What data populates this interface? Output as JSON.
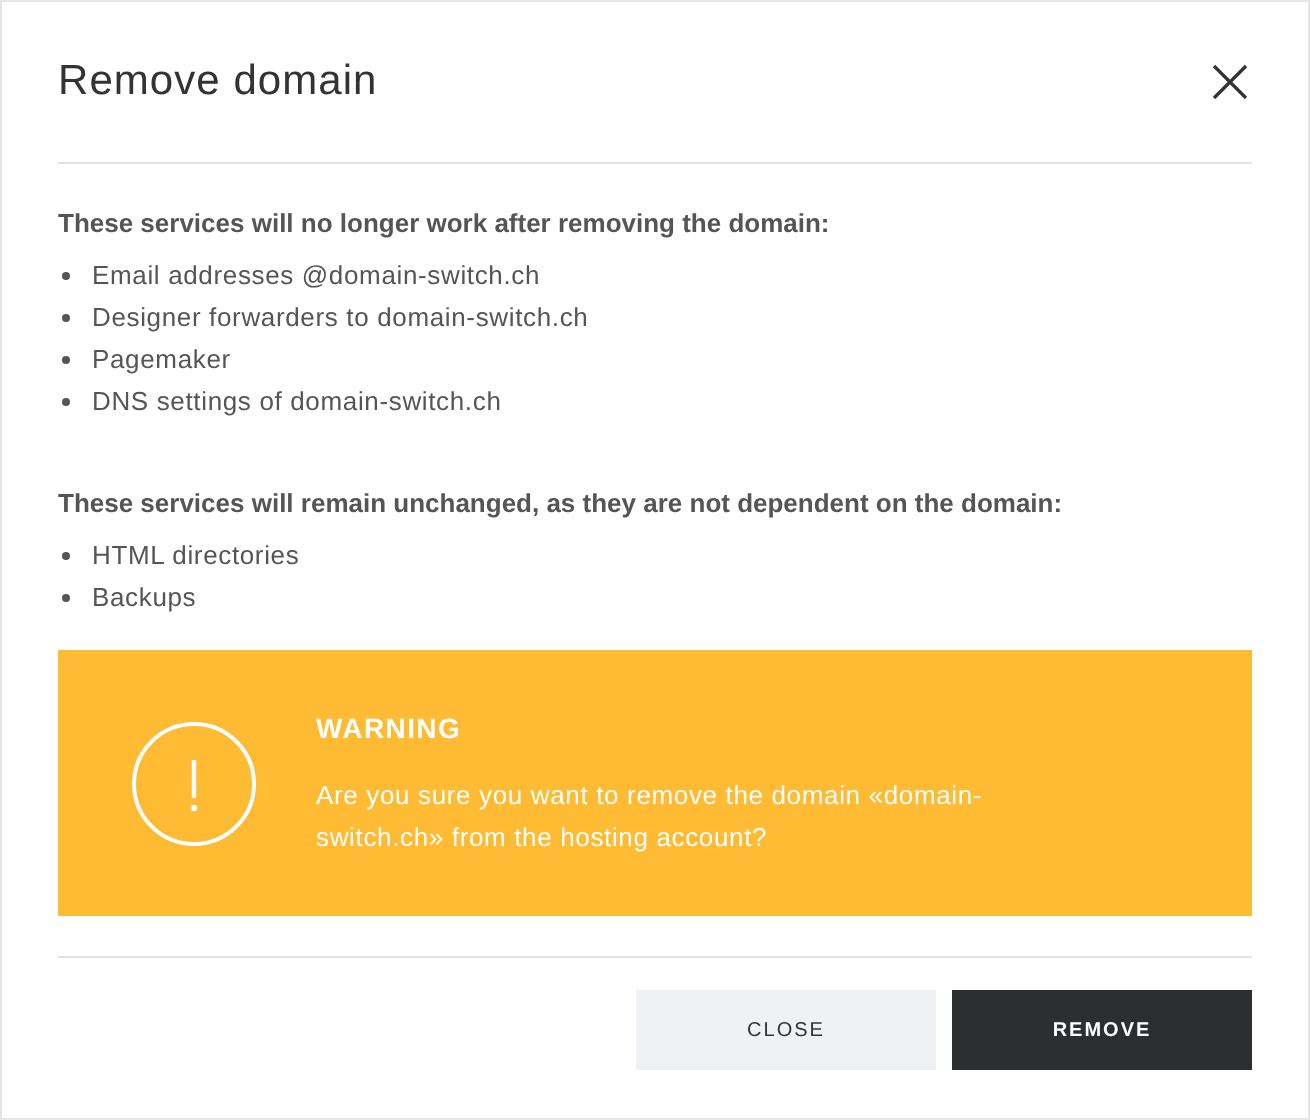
{
  "dialog": {
    "title": "Remove domain",
    "sections": [
      {
        "heading": "These services will no longer work after removing the domain:",
        "items": [
          "Email addresses @domain-switch.ch",
          "Designer forwarders to domain-switch.ch",
          "Pagemaker",
          "DNS settings of domain-switch.ch"
        ]
      },
      {
        "heading": "These services will remain unchanged, as they are not dependent on the domain:",
        "items": [
          "HTML directories",
          "Backups"
        ]
      }
    ],
    "warning": {
      "title": "WARNING",
      "message": "Are you sure you want to remove the domain «domain-switch.ch» from the hosting account?"
    },
    "buttons": [
      {
        "label": "CLOSE",
        "kind": "secondary"
      },
      {
        "label": "REMOVE",
        "kind": "primary"
      }
    ]
  }
}
